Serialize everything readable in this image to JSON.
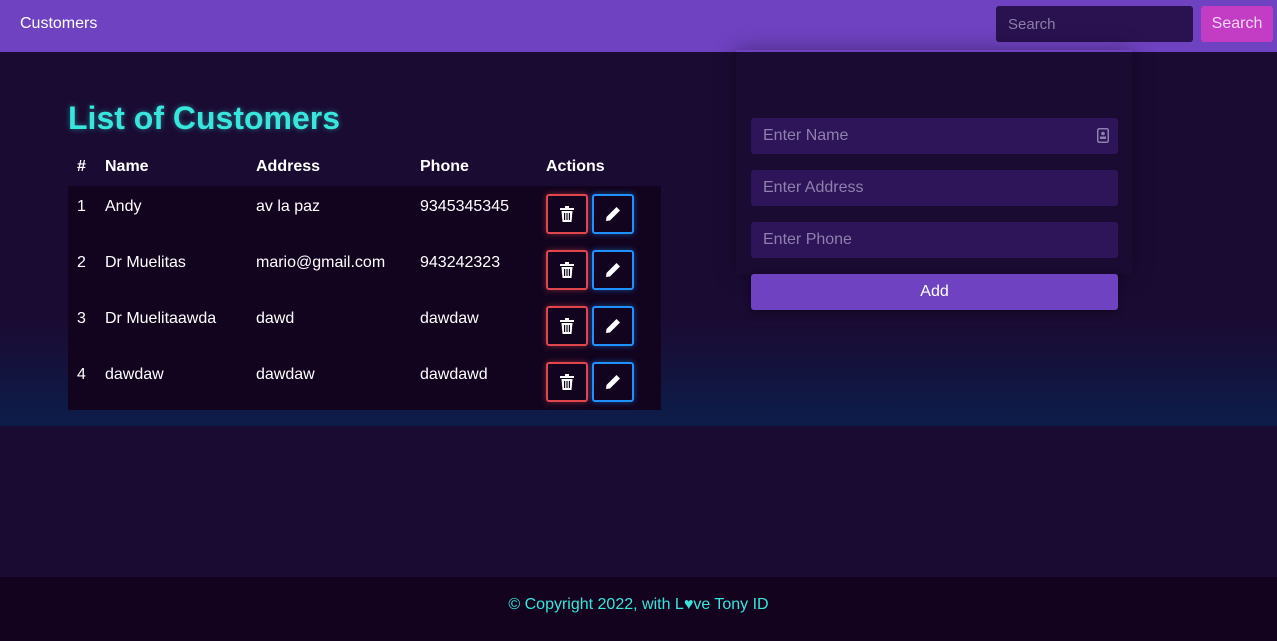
{
  "navbar": {
    "brand": "Customers",
    "search_placeholder": "Search",
    "search_button": "Search"
  },
  "main": {
    "title": "List of Customers",
    "table": {
      "headers": [
        "#",
        "Name",
        "Address",
        "Phone",
        "Actions"
      ],
      "rows": [
        {
          "num": "1",
          "name": "Andy",
          "address": "av la paz",
          "phone": "9345345345"
        },
        {
          "num": "2",
          "name": "Dr Muelitas",
          "address": "mario@gmail.com",
          "phone": "943242323"
        },
        {
          "num": "3",
          "name": "Dr Muelitaawda",
          "address": "dawd",
          "phone": "dawdaw"
        },
        {
          "num": "4",
          "name": "dawdaw",
          "address": "dawdaw",
          "phone": "dawdawd"
        }
      ]
    }
  },
  "form": {
    "name_placeholder": "Enter Name",
    "address_placeholder": "Enter Address",
    "phone_placeholder": "Enter Phone",
    "add_button": "Add"
  },
  "footer": {
    "copyright": "© Copyright 2022, with L♥ve Tony ID"
  },
  "colors": {
    "navbar": "#6f42c1",
    "accent": "#38e6dc",
    "search_button": "#c23cc4",
    "delete": "#e0474c",
    "edit": "#1e90ff"
  }
}
